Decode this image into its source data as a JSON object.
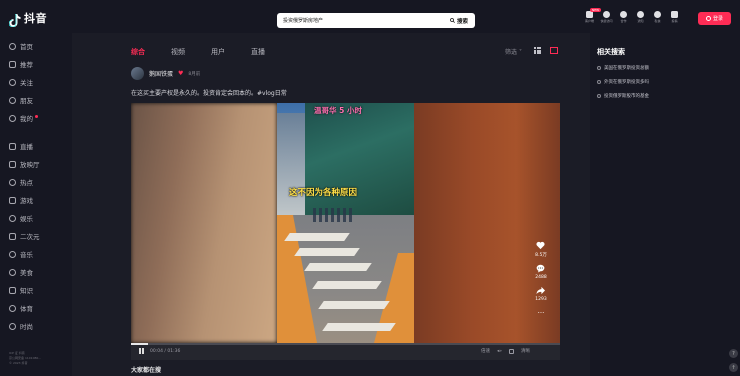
{
  "app": {
    "logo_text": "抖音"
  },
  "search": {
    "value": "投资俄罗斯房地产",
    "button_label": "搜索"
  },
  "top_icons": [
    {
      "label": "客户端",
      "badge": "NEW"
    },
    {
      "label": "快捷访问"
    },
    {
      "label": "合作"
    },
    {
      "label": "通知"
    },
    {
      "label": "私信"
    },
    {
      "label": "投稿"
    }
  ],
  "login": {
    "label": "登录"
  },
  "sidebar": {
    "items": [
      {
        "label": "首页",
        "icon": "home-icon"
      },
      {
        "label": "推荐",
        "icon": "thumb-icon"
      },
      {
        "label": "关注",
        "icon": "person-icon"
      },
      {
        "label": "朋友",
        "icon": "friends-icon"
      },
      {
        "label": "我的",
        "icon": "user-icon"
      },
      {
        "label": "直播",
        "icon": "live-icon"
      },
      {
        "label": "放映厅",
        "icon": "cinema-icon"
      },
      {
        "label": "热点",
        "icon": "fire-icon"
      },
      {
        "label": "游戏",
        "icon": "game-icon"
      },
      {
        "label": "娱乐",
        "icon": "smile-icon"
      },
      {
        "label": "二次元",
        "icon": "tv-icon"
      },
      {
        "label": "音乐",
        "icon": "music-icon"
      },
      {
        "label": "美食",
        "icon": "food-icon"
      },
      {
        "label": "知识",
        "icon": "book-icon"
      },
      {
        "label": "体育",
        "icon": "ball-icon"
      },
      {
        "label": "时尚",
        "icon": "hanger-icon"
      }
    ],
    "footer": [
      "ICP 证 抖音",
      "京公网安备 1101080...",
      "© 2023 抖音"
    ]
  },
  "main": {
    "tabs": [
      "综合",
      "视频",
      "用户",
      "直播"
    ],
    "active_tab": 0,
    "filter_label": "筛选"
  },
  "post": {
    "author": "鹅国铁蛋",
    "date": "8月前",
    "caption": "在这买主要产权是永久的。投资肯定会回本的。#vlog日常",
    "overlay_top": "温哥华 5 小时",
    "overlay_middle": "这不因为各种原因",
    "likes": "8.5万",
    "comments": "2488",
    "shares": "1293",
    "more": "...",
    "time": "00:04 / 01:36",
    "progress": 0.04,
    "controls_right": [
      "倍速",
      "清晰"
    ],
    "also_searching": "大家都在搜"
  },
  "related": {
    "title": "相关搜索",
    "items": [
      "美国在俄罗斯投资总额",
      "外资在俄罗斯投资多吗",
      "投资俄罗斯股市的基金"
    ]
  },
  "colors": {
    "accent": "#fe2c55",
    "bg": "#161722",
    "panel": "#1b1c26"
  }
}
